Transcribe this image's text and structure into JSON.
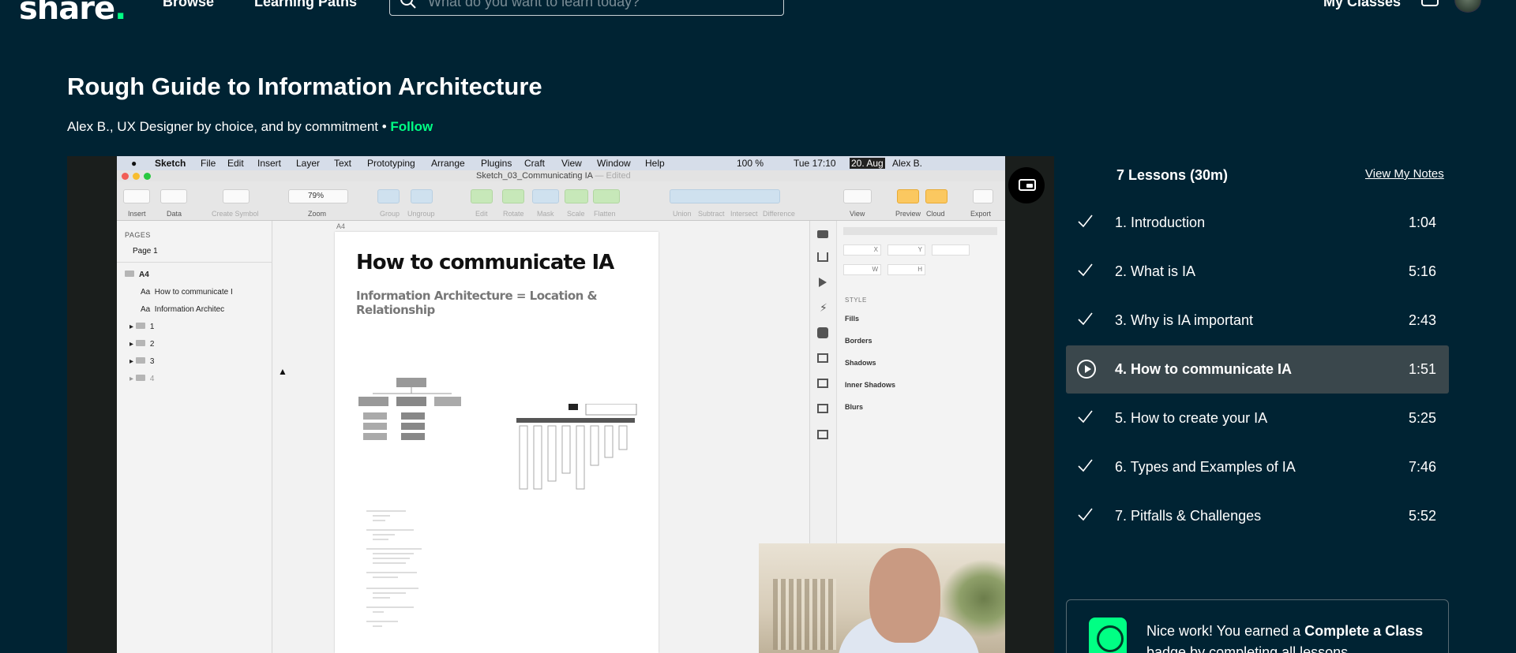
{
  "nav": {
    "logo": "share",
    "logo_dot": ".",
    "browse": "Browse",
    "learning_paths": "Learning Paths",
    "search_placeholder": "What do you want to learn today?",
    "my_classes": "My Classes"
  },
  "course": {
    "title": "Rough Guide to Information Architecture",
    "author": "Alex B., UX Designer by choice, and by commitment",
    "separator": " • ",
    "follow": "Follow"
  },
  "video": {
    "menubar": {
      "app": "Sketch",
      "items": [
        "File",
        "Edit",
        "Insert",
        "Layer",
        "Text",
        "Prototyping",
        "Arrange",
        "Plugins",
        "Craft",
        "View",
        "Window",
        "Help"
      ],
      "battery": "100 %",
      "clock": "Tue 17:10",
      "date_badge": "20. Aug",
      "user": "Alex B."
    },
    "document_title": "Sketch_03_Communicating IA",
    "document_status": "— Edited",
    "toolbar_labels": [
      "Insert",
      "Data",
      "Create Symbol",
      "Zoom",
      "Group",
      "Ungroup",
      "Edit",
      "Rotate",
      "Mask",
      "Scale",
      "Flatten",
      "Union",
      "Subtract",
      "Intersect",
      "Difference",
      "View",
      "Preview",
      "Cloud",
      "Export"
    ],
    "zoom": "79%",
    "pages_label": "PAGES",
    "page_name": "Page 1",
    "artboard_name": "A4",
    "layers": [
      "How to communicate I",
      "Information Architec",
      "1",
      "2",
      "3",
      "4"
    ],
    "canvas_label": "A4",
    "artboard_heading": "How to communicate IA",
    "artboard_subheading": "Information Architecture = Location & Relationship",
    "inspector": {
      "style": "STYLE",
      "sections": [
        "Fills",
        "Borders",
        "Shadows",
        "Inner Shadows",
        "Blurs"
      ],
      "fields": [
        "X",
        "Y",
        "W",
        "H"
      ]
    }
  },
  "lessons": {
    "header": "7 Lessons (30m)",
    "view_notes": "View My Notes",
    "items": [
      {
        "title": "1. Introduction",
        "duration": "1:04",
        "state": "done"
      },
      {
        "title": "2. What is IA",
        "duration": "5:16",
        "state": "done"
      },
      {
        "title": "3. Why is IA important",
        "duration": "2:43",
        "state": "done"
      },
      {
        "title": "4. How to communicate IA",
        "duration": "1:51",
        "state": "playing"
      },
      {
        "title": "5. How to create your IA",
        "duration": "5:25",
        "state": "done"
      },
      {
        "title": "6. Types and Examples of IA",
        "duration": "7:46",
        "state": "done"
      },
      {
        "title": "7. Pitfalls & Challenges",
        "duration": "5:52",
        "state": "done"
      }
    ]
  },
  "badge": {
    "text_before": "Nice work! You earned a ",
    "bold": "Complete a Class",
    "text_after": " badge by completing all lessons"
  },
  "colors": {
    "background": "#002333",
    "accent": "#00ff84",
    "active_row": "#3a474c"
  }
}
